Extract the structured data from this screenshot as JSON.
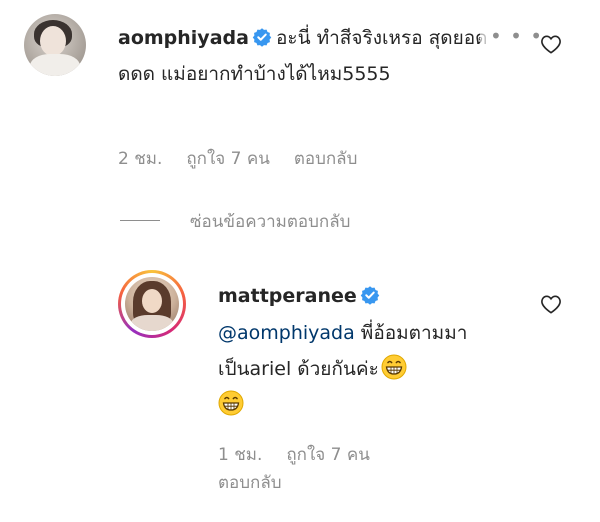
{
  "comment": {
    "username": "aomphiyada",
    "text": "อะนี่ ทำสีจริงเหรอ สุดยอดดดด แม่อยากทำบ้างได้ไหม5555",
    "more_glyph": "• • •",
    "time": "2 ชม.",
    "likes": "ถูกใจ 7 คน",
    "reply_label": "ตอบกลับ",
    "hide_replies_label": "ซ่อนข้อความตอบกลับ"
  },
  "reply": {
    "username": "mattperanee",
    "mention": "@aomphiyada",
    "text": " พี่อ้อมตามมาเป็นariel ด้วยกันค่ะ",
    "time": "1 ชม.",
    "likes": "ถูกใจ 7 คน",
    "reply_label": "ตอบกลับ"
  },
  "colors": {
    "text": "#262626",
    "secondary": "#8e8e8e",
    "verified": "#3897f0",
    "mention": "#00376b"
  },
  "icons": {
    "verified": "verified-badge-icon",
    "like": "heart-outline-icon",
    "more": "more-options-icon",
    "emoji": "grinning-face-emoji"
  }
}
